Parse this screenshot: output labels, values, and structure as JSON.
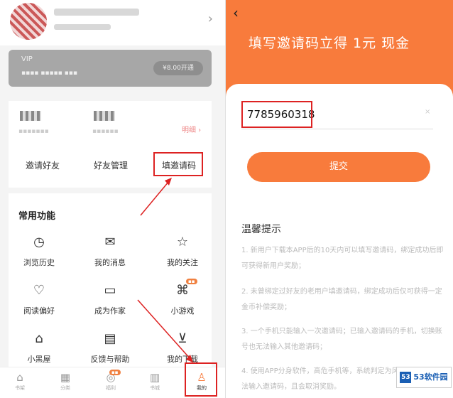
{
  "left": {
    "vip_btn": "¥8.00开通",
    "detail_link": "明细",
    "row3": [
      "邀请好友",
      "好友管理",
      "填邀请码"
    ],
    "section_title": "常用功能",
    "functions": [
      {
        "label": "浏览历史",
        "icon": "clock-icon"
      },
      {
        "label": "我的消息",
        "icon": "message-icon"
      },
      {
        "label": "我的关注",
        "icon": "star-icon"
      },
      {
        "label": "阅读偏好",
        "icon": "heart-icon"
      },
      {
        "label": "成为作家",
        "icon": "monitor-icon"
      },
      {
        "label": "小游戏",
        "icon": "gamepad-icon"
      },
      {
        "label": "小黑屋",
        "icon": "house-icon"
      },
      {
        "label": "反馈与帮助",
        "icon": "feedback-icon"
      },
      {
        "label": "我的下载",
        "icon": "download-icon"
      }
    ],
    "tabs": [
      {
        "label": "书架",
        "icon": "home-icon"
      },
      {
        "label": "分类",
        "icon": "grid-icon"
      },
      {
        "label": "福利",
        "icon": "gift-icon"
      },
      {
        "label": "书城",
        "icon": "book-icon"
      },
      {
        "label": "我的",
        "icon": "user-icon"
      }
    ]
  },
  "right": {
    "banner": "填写邀请码立得 1元 现金",
    "code_value": "7785960318",
    "submit_label": "提交",
    "tips_title": "温馨提示",
    "tips": [
      "1. 新用户下载本APP后的10天内可以填写邀请码，绑定成功后即可获得新用户奖励；",
      "2. 未曾绑定过好友的老用户填邀请码，绑定成功后仅可获得一定金币补偿奖励；",
      "3. 一个手机只能输入一次邀请码；已输入邀请码的手机，切换账号也无法输入其他邀请码；",
      "4. 使用APP分身软件，高危手机等，系统判定为风险用户，将无法输入邀请码，且会取消奖励。"
    ],
    "logo": "53软件园"
  }
}
